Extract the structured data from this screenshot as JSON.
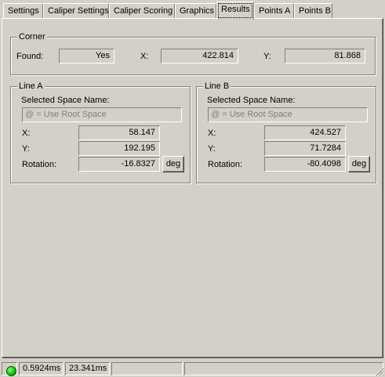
{
  "tabs": [
    "Settings",
    "Caliper Settings",
    "Caliper Scoring",
    "Graphics",
    "Results",
    "Points A",
    "Points B"
  ],
  "active_tab": "Results",
  "corner": {
    "title": "Corner",
    "found_label": "Found:",
    "found_value": "Yes",
    "x_label": "X:",
    "x_value": "422.814",
    "y_label": "Y:",
    "y_value": "81.868"
  },
  "line_a": {
    "title": "Line A",
    "space_label": "Selected Space Name:",
    "space_placeholder": "@ = Use Root Space",
    "x_label": "X:",
    "x_value": "58.147",
    "y_label": "Y:",
    "y_value": "192.195",
    "rotation_label": "Rotation:",
    "rotation_value": "-16.8327",
    "unit_button": "deg"
  },
  "line_b": {
    "title": "Line B",
    "space_label": "Selected Space Name:",
    "space_placeholder": "@ = Use Root Space",
    "x_label": "X:",
    "x_value": "424.527",
    "y_label": "Y:",
    "y_value": "71.7284",
    "rotation_label": "Rotation:",
    "rotation_value": "-80.4098",
    "unit_button": "deg"
  },
  "status": {
    "time1": "0.5924ms",
    "time2": "23.341ms",
    "indicator_color": "#00c000"
  }
}
